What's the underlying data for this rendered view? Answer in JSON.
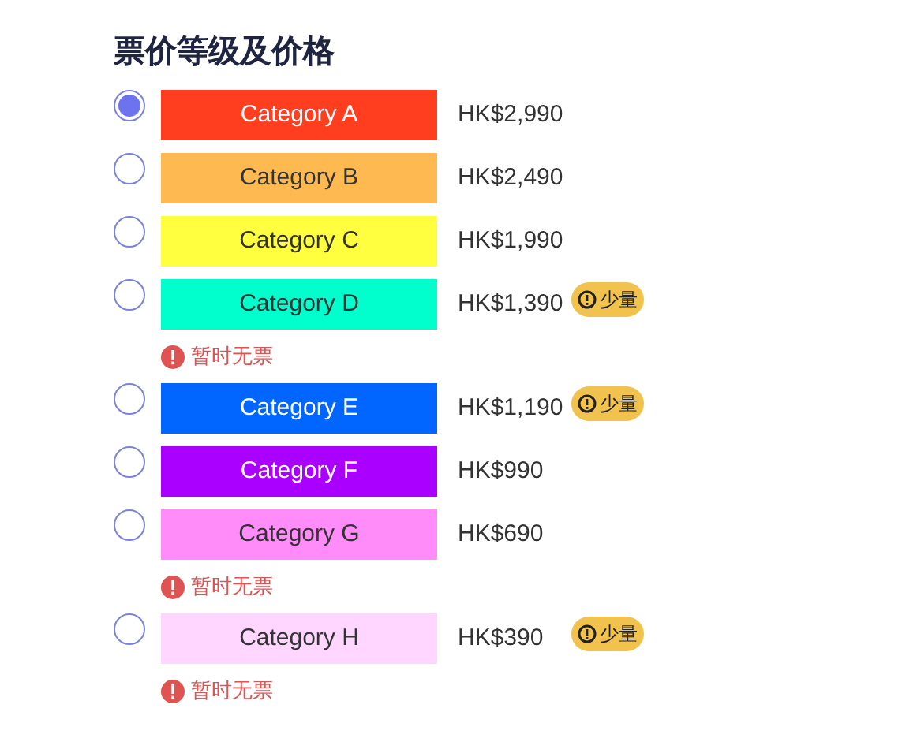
{
  "title": "票价等级及价格",
  "categories": [
    {
      "name": "Category A",
      "color": "#ff3d1f",
      "price": "HK$2,990",
      "selected": true
    },
    {
      "name": "Category B",
      "color": "#ffb951",
      "price": "HK$2,490",
      "selected": false
    },
    {
      "name": "Category C",
      "color": "#ffff40",
      "price": "HK$1,990",
      "selected": false
    },
    {
      "name": "Category D",
      "color": "#00ffcc",
      "price": "HK$1,390",
      "selected": false,
      "badge": "少量",
      "notice": "暂时无票"
    },
    {
      "name": "Category E",
      "color": "#0066ff",
      "price": "HK$1,190",
      "selected": false,
      "badge": "少量"
    },
    {
      "name": "Category F",
      "color": "#aa00ff",
      "price": "HK$990",
      "selected": false
    },
    {
      "name": "Category G",
      "color": "#ff8cf9",
      "price": "HK$690",
      "selected": false,
      "notice": "暂时无票"
    },
    {
      "name": "Category H",
      "color": "#ffd6ff",
      "price": "HK$390",
      "selected": false,
      "badge": "少量",
      "notice": "暂时无票"
    }
  ]
}
